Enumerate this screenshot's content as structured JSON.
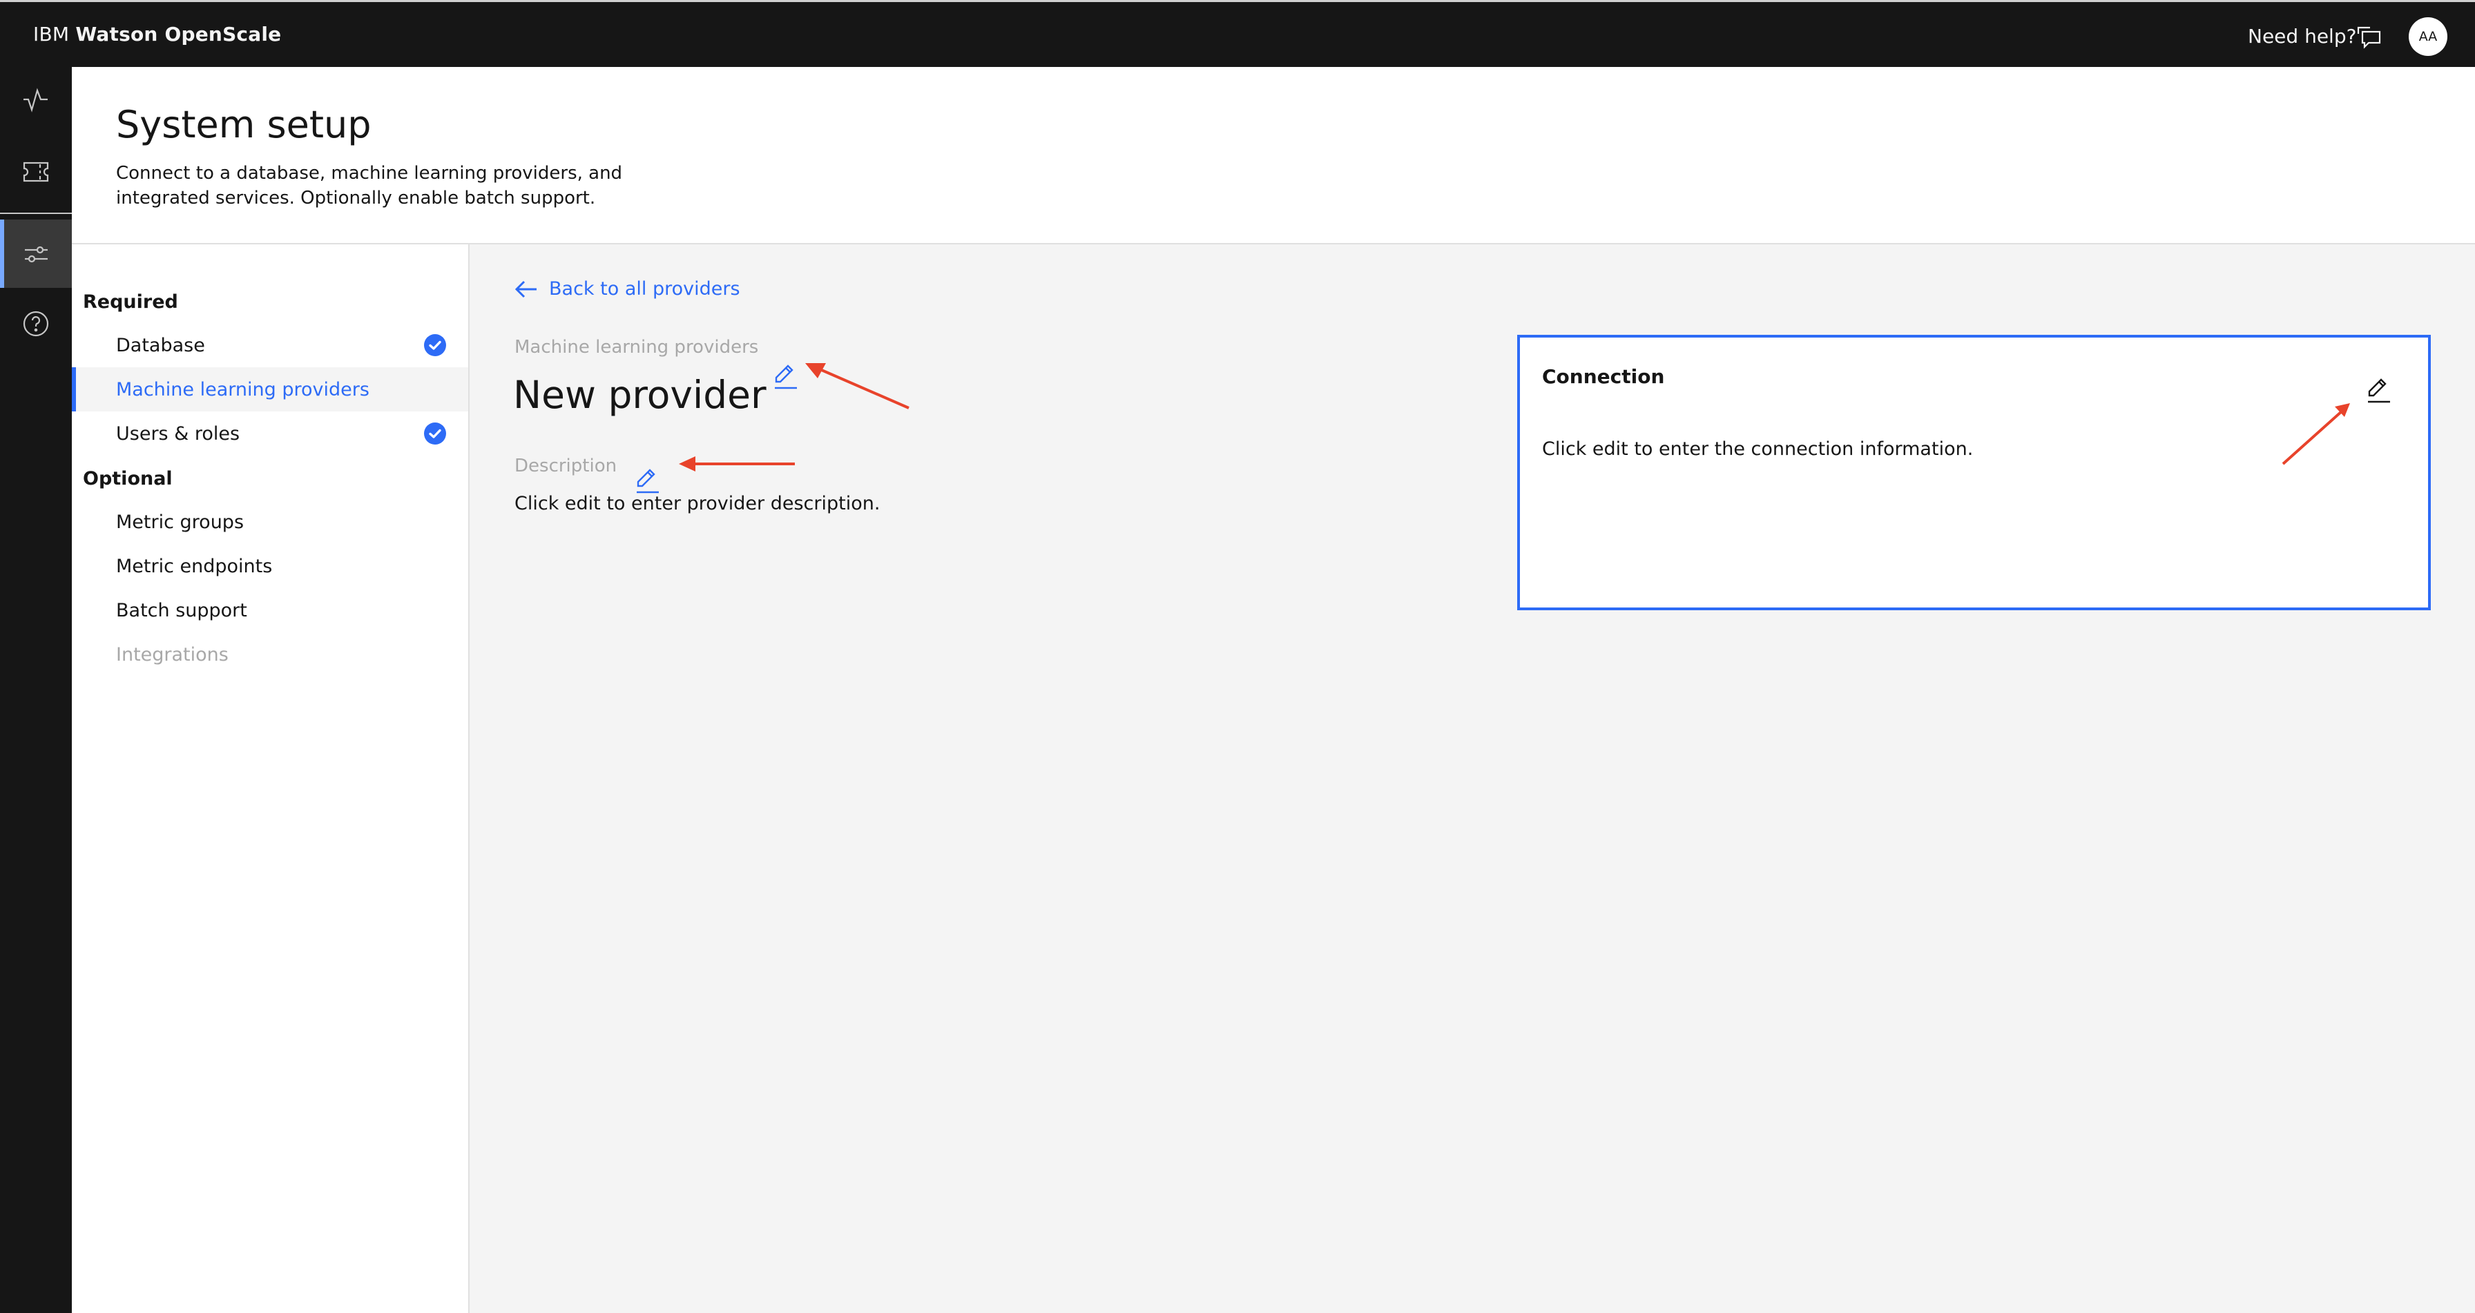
{
  "header": {
    "brand_prefix": "IBM",
    "brand_name": "Watson OpenScale",
    "help_label": "Need help?",
    "help_icon": "chat-icon",
    "avatar_initials": "AA"
  },
  "rail": {
    "items": [
      {
        "icon": "activity-icon",
        "active": false
      },
      {
        "icon": "ticket-icon",
        "active": false
      },
      {
        "icon": "sliders-icon",
        "active": true
      },
      {
        "icon": "help-circle-icon",
        "active": false
      }
    ]
  },
  "page": {
    "title": "System setup",
    "description": "Connect to a database, machine learning providers, and integrated services. Optionally enable batch support."
  },
  "sidenav": {
    "sections": [
      {
        "label": "Required",
        "items": [
          {
            "label": "Database",
            "status": "complete"
          },
          {
            "label": "Machine learning providers",
            "status": "active"
          },
          {
            "label": "Users & roles",
            "status": "complete"
          }
        ]
      },
      {
        "label": "Optional",
        "items": [
          {
            "label": "Metric groups",
            "status": "none"
          },
          {
            "label": "Metric endpoints",
            "status": "none"
          },
          {
            "label": "Batch support",
            "status": "none"
          },
          {
            "label": "Integrations",
            "status": "disabled"
          }
        ]
      }
    ]
  },
  "content": {
    "back_label": "Back to all providers",
    "provider_type_label": "Machine learning providers",
    "provider_name": "New provider",
    "description_label": "Description",
    "description_placeholder": "Click edit to enter provider description.",
    "connection": {
      "title": "Connection",
      "placeholder": "Click edit to enter the connection information."
    }
  },
  "colors": {
    "accent": "#2d6bf6",
    "header_bg": "#161616",
    "rail_active": "#78a9ff",
    "annotation_arrow": "#e8432b",
    "check": "#0f62fe"
  }
}
